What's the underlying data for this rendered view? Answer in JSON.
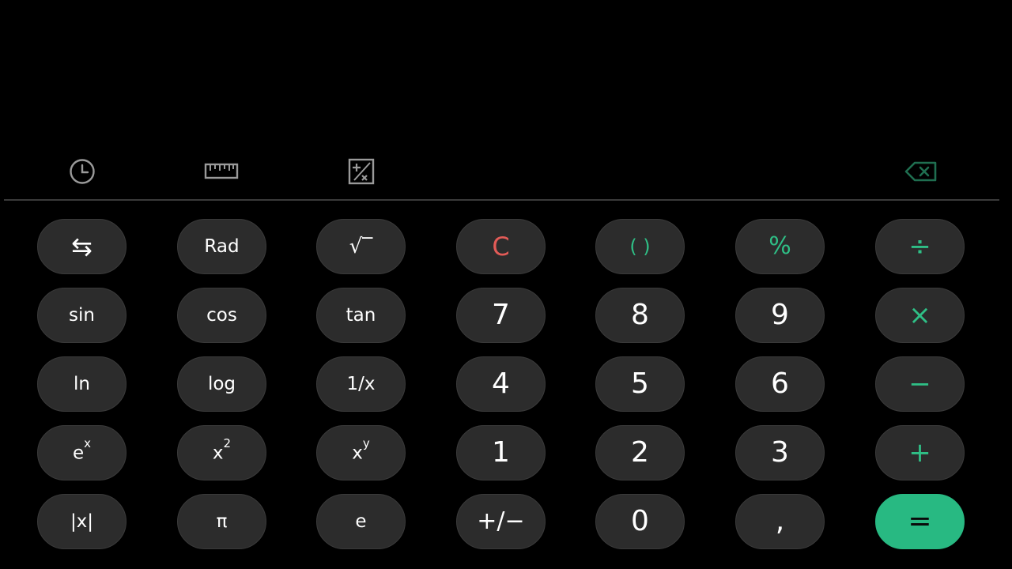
{
  "display": {
    "expression": "",
    "result": ""
  },
  "toolbar": {
    "history_icon": "clock-icon",
    "converter_icon": "ruler-icon",
    "scientific_icon": "plus-minus-square-icon",
    "backspace_icon": "backspace-icon"
  },
  "keys": {
    "swap": "⇆",
    "rad": "Rad",
    "sqrt": "√‾",
    "clear": "C",
    "parens": "( )",
    "percent": "%",
    "divide": "÷",
    "sin": "sin",
    "cos": "cos",
    "tan": "tan",
    "seven": "7",
    "eight": "8",
    "nine": "9",
    "multiply": "×",
    "ln": "ln",
    "log": "log",
    "reciprocal": "1/x",
    "four": "4",
    "five": "5",
    "six": "6",
    "minus": "−",
    "exp_base": "e",
    "exp_sup": "x",
    "square_base": "x",
    "square_sup": "2",
    "power_base": "x",
    "power_sup": "y",
    "one": "1",
    "two": "2",
    "three": "3",
    "plus": "+",
    "abs": "|x|",
    "pi": "π",
    "e": "e",
    "negate": "+/−",
    "zero": "0",
    "comma": ",",
    "equals": "="
  },
  "colors": {
    "accent": "#2fbf86",
    "clear": "#e25b57",
    "key_bg": "#2c2c2c",
    "background": "#000000"
  }
}
